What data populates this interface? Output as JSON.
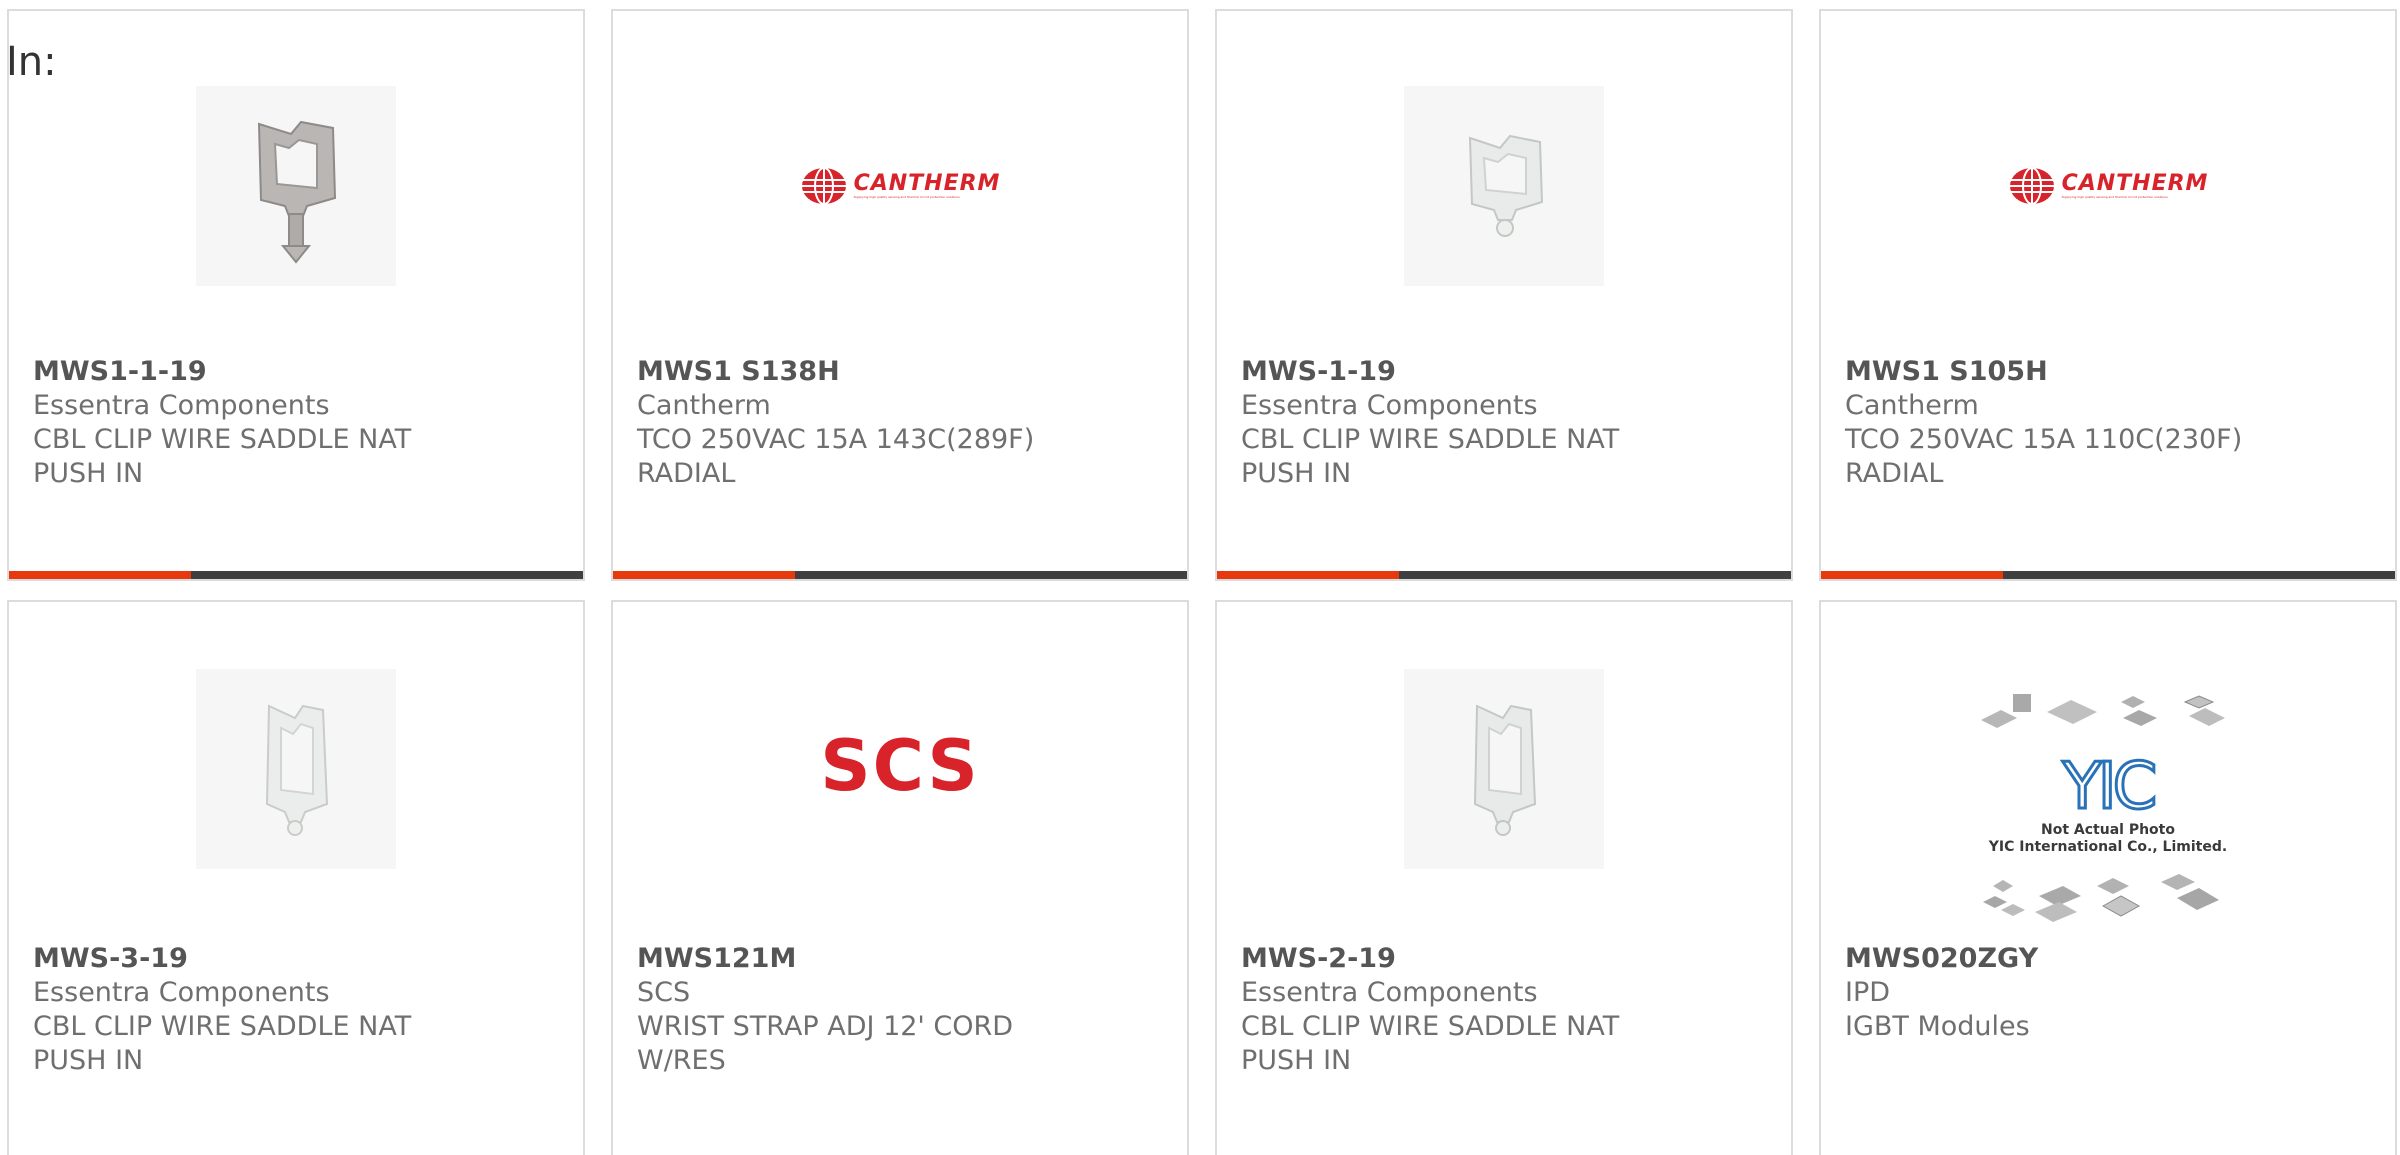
{
  "header": {
    "in_label": "In:"
  },
  "colors": {
    "accent": "#e8380d",
    "bar_dark": "#3f3f3f",
    "brand_red": "#d8232a"
  },
  "products": [
    {
      "part_number": "MWS1-1-19",
      "manufacturer": "Essentra Components",
      "description_line1": "CBL CLIP WIRE SADDLE NAT",
      "description_line2": "PUSH IN",
      "image": "wire-saddle-clip-grey"
    },
    {
      "part_number": "MWS1 S138H",
      "manufacturer": "Cantherm",
      "description_line1": "TCO 250VAC 15A 143C(289F)",
      "description_line2": "RADIAL",
      "image": "cantherm-logo"
    },
    {
      "part_number": "MWS-1-19",
      "manufacturer": "Essentra Components",
      "description_line1": "CBL CLIP WIRE SADDLE NAT",
      "description_line2": "PUSH IN",
      "image": "wire-saddle-clip-white"
    },
    {
      "part_number": "MWS1 S105H",
      "manufacturer": "Cantherm",
      "description_line1": "TCO 250VAC 15A 110C(230F)",
      "description_line2": "RADIAL",
      "image": "cantherm-logo"
    },
    {
      "part_number": "MWS-3-19",
      "manufacturer": "Essentra Components",
      "description_line1": "CBL CLIP WIRE SADDLE NAT",
      "description_line2": "PUSH IN",
      "image": "wire-saddle-clip-white-tall"
    },
    {
      "part_number": "MWS121M",
      "manufacturer": "SCS",
      "description_line1": "WRIST STRAP ADJ 12' CORD",
      "description_line2": "W/RES",
      "image": "scs-logo"
    },
    {
      "part_number": "MWS-2-19",
      "manufacturer": "Essentra Components",
      "description_line1": "CBL CLIP WIRE SADDLE NAT",
      "description_line2": "PUSH IN",
      "image": "wire-saddle-clip-white-tall"
    },
    {
      "part_number": "MWS020ZGY",
      "manufacturer": "IPD",
      "description_line1": "IGBT Modules",
      "description_line2": "",
      "image": "yic-placeholder",
      "placeholder_text1": "Not Actual Photo",
      "placeholder_text2": "YIC International Co., Limited."
    }
  ],
  "logos": {
    "cantherm_text": "CANTHERM",
    "cantherm_tagline": "Supplying high quality sensing and thermal circuit protection solutions",
    "scs_text": "SCS",
    "yic_text": "YIC"
  }
}
